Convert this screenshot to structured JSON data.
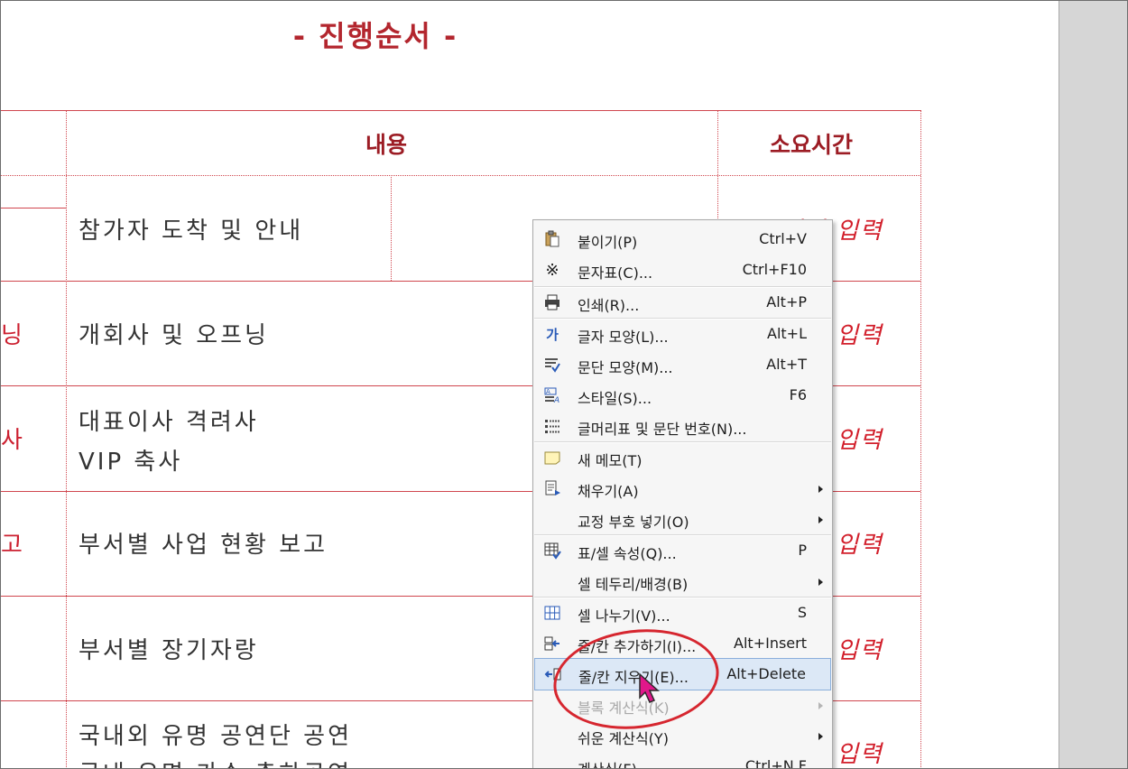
{
  "document": {
    "title": "- 진행순서 -",
    "headers": {
      "content": "내용",
      "duration": "소요시간"
    },
    "rows": [
      {
        "left_fragment": "",
        "content": [
          "참가자 도착 및 안내"
        ],
        "time": "소요시간 입력"
      },
      {
        "left_fragment": "닝",
        "content": [
          "개회사 및 오프닝"
        ],
        "time": "소요시간 입력"
      },
      {
        "left_fragment": "사",
        "content": [
          "대표이사 격려사",
          "VIP 축사"
        ],
        "time": "소요시간 입력"
      },
      {
        "left_fragment": "고",
        "content": [
          "부서별 사업 현황 보고"
        ],
        "time": "소요시간 입력"
      },
      {
        "left_fragment": "",
        "content": [
          "부서별 장기자랑"
        ],
        "time": "소요시간 입력"
      },
      {
        "left_fragment": "",
        "content": [
          "국내외 유명 공연단 공연",
          "국내 유명 가수 축하공연"
        ],
        "time": "소요시간 입력"
      }
    ]
  },
  "context_menu": {
    "items": [
      {
        "icon": "paste-icon",
        "label": "붙이기(P)",
        "shortcut": "Ctrl+V"
      },
      {
        "icon": "symbol-icon",
        "label": "문자표(C)...",
        "shortcut": "Ctrl+F10"
      },
      {
        "icon": "print-icon",
        "label": "인쇄(R)...",
        "shortcut": "Alt+P"
      },
      {
        "icon": "char-shape-icon",
        "label": "글자 모양(L)...",
        "shortcut": "Alt+L"
      },
      {
        "icon": "paragraph-shape-icon",
        "label": "문단 모양(M)...",
        "shortcut": "Alt+T"
      },
      {
        "icon": "style-icon",
        "label": "스타일(S)...",
        "shortcut": "F6"
      },
      {
        "icon": "bullet-numbering-icon",
        "label": "글머리표 및 문단 번호(N)...",
        "shortcut": ""
      },
      {
        "icon": "memo-icon",
        "label": "새 메모(T)",
        "shortcut": ""
      },
      {
        "icon": "fill-icon",
        "label": "채우기(A)",
        "shortcut": "",
        "submenu": true
      },
      {
        "icon": "",
        "label": "교정 부호 넣기(O)",
        "shortcut": "",
        "submenu": true
      },
      {
        "icon": "table-cell-props-icon",
        "label": "표/셀 속성(Q)...",
        "shortcut": "P"
      },
      {
        "icon": "",
        "label": "셀 테두리/배경(B)",
        "shortcut": "",
        "submenu": true
      },
      {
        "icon": "split-cell-icon",
        "label": "셀 나누기(V)...",
        "shortcut": "S"
      },
      {
        "icon": "insert-row-col-icon",
        "label": "줄/칸 추가하기(I)...",
        "shortcut": "Alt+Insert"
      },
      {
        "icon": "delete-row-col-icon",
        "label": "줄/칸 지우기(E)...",
        "shortcut": "Alt+Delete",
        "highlighted": true
      },
      {
        "icon": "",
        "label": "블록 계산식(K)",
        "shortcut": "",
        "submenu": true,
        "disabled": true
      },
      {
        "icon": "",
        "label": "쉬운 계산식(Y)",
        "shortcut": "",
        "submenu": true
      },
      {
        "icon": "",
        "label": "계산식(F)...",
        "shortcut": "Ctrl+N,F"
      }
    ]
  },
  "colors": {
    "accent_red": "#d21f2b",
    "title_red": "#b3262e",
    "highlight_bg": "#dce8f6"
  }
}
